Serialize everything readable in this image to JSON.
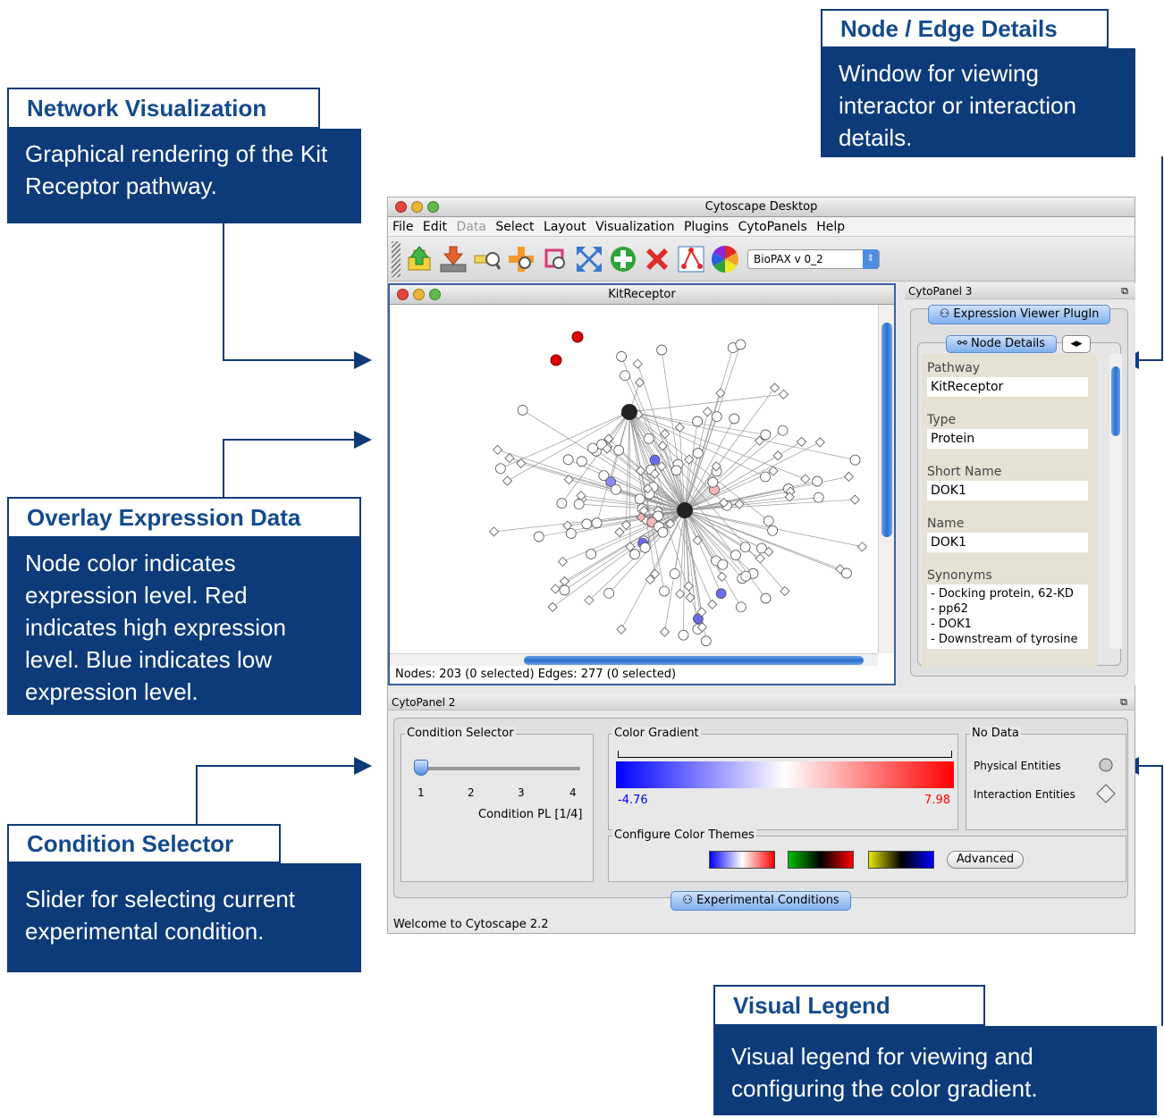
{
  "callouts": {
    "network": {
      "title": "Network Visualization",
      "body": "Graphical rendering of the Kit Receptor pathway."
    },
    "details": {
      "title": "Node / Edge Details",
      "body": "Window for viewing interactor or interaction details."
    },
    "overlay": {
      "title": "Overlay Expression Data",
      "body": "Node color indicates expression level.  Red indicates high expression level.  Blue indicates low expression level."
    },
    "condition": {
      "title": "Condition Selector",
      "body": "Slider for selecting current experimental condition."
    },
    "legend": {
      "title": "Visual Legend",
      "body": "Visual legend for viewing and configuring the color gradient."
    }
  },
  "window": {
    "title": "Cytoscape Desktop",
    "menu": [
      "File",
      "Edit",
      "Data",
      "Select",
      "Layout",
      "Visualization",
      "Plugins",
      "CytoPanels",
      "Help"
    ],
    "toolbar_icons": [
      "open-icon",
      "save-icon",
      "zoom-in-icon",
      "zoom-out-icon",
      "zoom-selected-icon",
      "fit-icon",
      "add-icon",
      "delete-icon",
      "vizmapper-icon",
      "color-wheel-icon"
    ],
    "combo_value": "BioPAX v 0_2",
    "status": "Welcome to Cytoscape 2.2"
  },
  "network": {
    "title": "KitReceptor",
    "status": "Nodes: 203 (0 selected) Edges: 277 (0 selected)"
  },
  "cytopanel3": {
    "title": "CytoPanel 3",
    "plugin_button": "Expression Viewer PlugIn",
    "tab": "Node Details",
    "fields": [
      {
        "label": "Pathway",
        "value": "KitReceptor"
      },
      {
        "label": "Type",
        "value": "Protein"
      },
      {
        "label": "Short Name",
        "value": "DOK1"
      },
      {
        "label": "Name",
        "value": "DOK1"
      }
    ],
    "synonyms_label": "Synonyms",
    "synonyms": [
      "- Docking protein, 62-KD",
      "- pp62",
      "- DOK1",
      "- Downstream of tyrosine"
    ]
  },
  "cytopanel2": {
    "title": "CytoPanel 2",
    "condition_selector": {
      "legend": "Condition Selector",
      "ticks": [
        "1",
        "2",
        "3",
        "4"
      ],
      "value": 1,
      "caption": "Condition PL [1/4]"
    },
    "color_gradient": {
      "legend": "Color Gradient",
      "min": "-4.76",
      "max": "7.98",
      "min_color": "#0000ff",
      "max_color": "#ff0000"
    },
    "no_data": {
      "legend": "No Data",
      "physical": "Physical Entities",
      "interaction": "Interaction Entities"
    },
    "themes": {
      "legend": "Configure Color Themes",
      "advanced": "Advanced"
    },
    "bottom_button": "Experimental Conditions"
  }
}
